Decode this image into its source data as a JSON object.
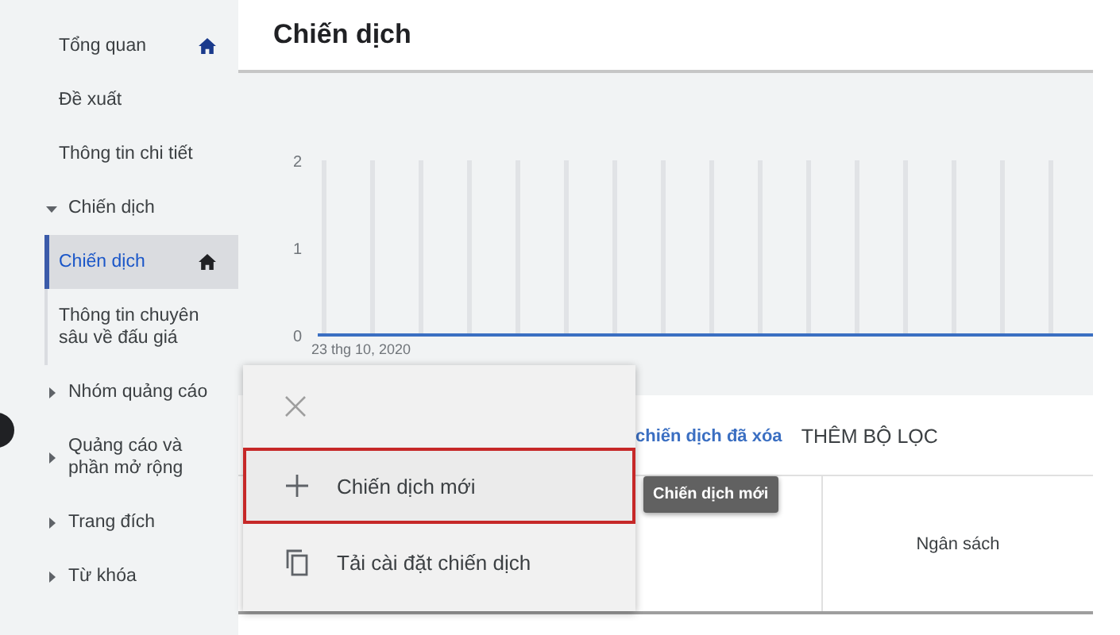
{
  "sidebar": {
    "items": [
      {
        "label": "Tổng quan",
        "kind": "page",
        "selected": false,
        "pinned": true
      },
      {
        "label": "Đề xuất",
        "kind": "page",
        "selected": false,
        "pinned": false
      },
      {
        "label": "Thông tin chi tiết",
        "kind": "page",
        "selected": false,
        "pinned": false
      },
      {
        "label": "Chiến dịch",
        "kind": "group",
        "expanded": true,
        "selected": false,
        "pinned": false,
        "children": [
          {
            "label": "Chiến dịch",
            "kind": "page",
            "selected": true,
            "pinned": true
          },
          {
            "label": "Thông tin chuyên sâu về đấu giá",
            "kind": "page",
            "selected": false,
            "pinned": false
          }
        ]
      },
      {
        "label": "Nhóm quảng cáo",
        "kind": "group",
        "expanded": false,
        "selected": false,
        "pinned": false
      },
      {
        "label": "Quảng cáo và phần mở rộng",
        "kind": "group",
        "expanded": false,
        "selected": false,
        "pinned": false
      },
      {
        "label": "Trang đích",
        "kind": "group",
        "expanded": false,
        "selected": false,
        "pinned": false
      },
      {
        "label": "Từ khóa",
        "kind": "group",
        "expanded": false,
        "selected": false,
        "pinned": false
      }
    ]
  },
  "page_title": "Chiến dịch",
  "chart": {
    "start_date": "23 thg 10, 2020",
    "chart_data": {
      "type": "line",
      "ylim": [
        0,
        2
      ],
      "yticks": [
        0,
        1,
        2
      ],
      "series": [
        {
          "color": "#3b6fc2",
          "values": [
            0,
            0,
            0,
            0,
            0,
            0,
            0,
            0,
            0,
            0,
            0,
            0,
            0,
            0,
            0,
            0
          ]
        }
      ]
    }
  },
  "filters": {
    "link": "chiến dịch đã xóa",
    "add_filter": "THÊM BỘ LỌC"
  },
  "table": {
    "columns": [
      "Ngân sách"
    ]
  },
  "menu": {
    "items": [
      {
        "label": "Chiến dịch mới",
        "kind": "create",
        "highlighted": true
      },
      {
        "label": "Tải cài đặt chiến dịch",
        "kind": "load",
        "highlighted": false
      }
    ]
  },
  "tooltip": "Chiến dịch mới"
}
